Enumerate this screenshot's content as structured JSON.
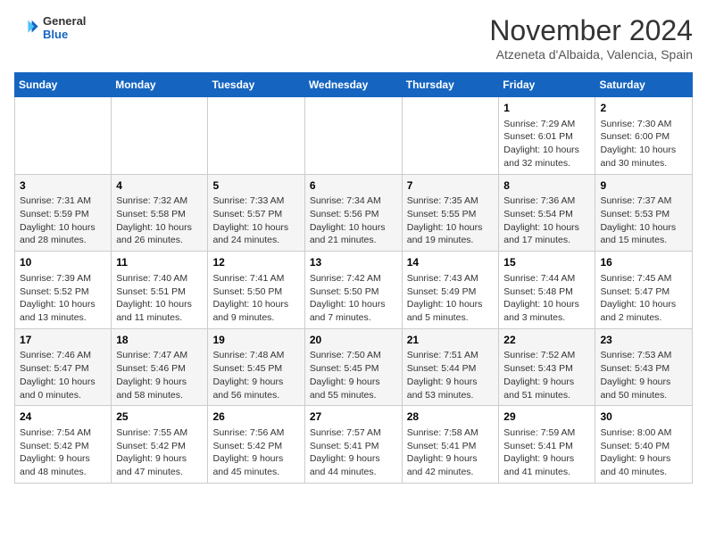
{
  "logo": {
    "line1": "General",
    "line2": "Blue"
  },
  "title": "November 2024",
  "location": "Atzeneta d'Albaida, Valencia, Spain",
  "days_of_week": [
    "Sunday",
    "Monday",
    "Tuesday",
    "Wednesday",
    "Thursday",
    "Friday",
    "Saturday"
  ],
  "weeks": [
    [
      {
        "day": "",
        "info": ""
      },
      {
        "day": "",
        "info": ""
      },
      {
        "day": "",
        "info": ""
      },
      {
        "day": "",
        "info": ""
      },
      {
        "day": "",
        "info": ""
      },
      {
        "day": "1",
        "info": "Sunrise: 7:29 AM\nSunset: 6:01 PM\nDaylight: 10 hours and 32 minutes."
      },
      {
        "day": "2",
        "info": "Sunrise: 7:30 AM\nSunset: 6:00 PM\nDaylight: 10 hours and 30 minutes."
      }
    ],
    [
      {
        "day": "3",
        "info": "Sunrise: 7:31 AM\nSunset: 5:59 PM\nDaylight: 10 hours and 28 minutes."
      },
      {
        "day": "4",
        "info": "Sunrise: 7:32 AM\nSunset: 5:58 PM\nDaylight: 10 hours and 26 minutes."
      },
      {
        "day": "5",
        "info": "Sunrise: 7:33 AM\nSunset: 5:57 PM\nDaylight: 10 hours and 24 minutes."
      },
      {
        "day": "6",
        "info": "Sunrise: 7:34 AM\nSunset: 5:56 PM\nDaylight: 10 hours and 21 minutes."
      },
      {
        "day": "7",
        "info": "Sunrise: 7:35 AM\nSunset: 5:55 PM\nDaylight: 10 hours and 19 minutes."
      },
      {
        "day": "8",
        "info": "Sunrise: 7:36 AM\nSunset: 5:54 PM\nDaylight: 10 hours and 17 minutes."
      },
      {
        "day": "9",
        "info": "Sunrise: 7:37 AM\nSunset: 5:53 PM\nDaylight: 10 hours and 15 minutes."
      }
    ],
    [
      {
        "day": "10",
        "info": "Sunrise: 7:39 AM\nSunset: 5:52 PM\nDaylight: 10 hours and 13 minutes."
      },
      {
        "day": "11",
        "info": "Sunrise: 7:40 AM\nSunset: 5:51 PM\nDaylight: 10 hours and 11 minutes."
      },
      {
        "day": "12",
        "info": "Sunrise: 7:41 AM\nSunset: 5:50 PM\nDaylight: 10 hours and 9 minutes."
      },
      {
        "day": "13",
        "info": "Sunrise: 7:42 AM\nSunset: 5:50 PM\nDaylight: 10 hours and 7 minutes."
      },
      {
        "day": "14",
        "info": "Sunrise: 7:43 AM\nSunset: 5:49 PM\nDaylight: 10 hours and 5 minutes."
      },
      {
        "day": "15",
        "info": "Sunrise: 7:44 AM\nSunset: 5:48 PM\nDaylight: 10 hours and 3 minutes."
      },
      {
        "day": "16",
        "info": "Sunrise: 7:45 AM\nSunset: 5:47 PM\nDaylight: 10 hours and 2 minutes."
      }
    ],
    [
      {
        "day": "17",
        "info": "Sunrise: 7:46 AM\nSunset: 5:47 PM\nDaylight: 10 hours and 0 minutes."
      },
      {
        "day": "18",
        "info": "Sunrise: 7:47 AM\nSunset: 5:46 PM\nDaylight: 9 hours and 58 minutes."
      },
      {
        "day": "19",
        "info": "Sunrise: 7:48 AM\nSunset: 5:45 PM\nDaylight: 9 hours and 56 minutes."
      },
      {
        "day": "20",
        "info": "Sunrise: 7:50 AM\nSunset: 5:45 PM\nDaylight: 9 hours and 55 minutes."
      },
      {
        "day": "21",
        "info": "Sunrise: 7:51 AM\nSunset: 5:44 PM\nDaylight: 9 hours and 53 minutes."
      },
      {
        "day": "22",
        "info": "Sunrise: 7:52 AM\nSunset: 5:43 PM\nDaylight: 9 hours and 51 minutes."
      },
      {
        "day": "23",
        "info": "Sunrise: 7:53 AM\nSunset: 5:43 PM\nDaylight: 9 hours and 50 minutes."
      }
    ],
    [
      {
        "day": "24",
        "info": "Sunrise: 7:54 AM\nSunset: 5:42 PM\nDaylight: 9 hours and 48 minutes."
      },
      {
        "day": "25",
        "info": "Sunrise: 7:55 AM\nSunset: 5:42 PM\nDaylight: 9 hours and 47 minutes."
      },
      {
        "day": "26",
        "info": "Sunrise: 7:56 AM\nSunset: 5:42 PM\nDaylight: 9 hours and 45 minutes."
      },
      {
        "day": "27",
        "info": "Sunrise: 7:57 AM\nSunset: 5:41 PM\nDaylight: 9 hours and 44 minutes."
      },
      {
        "day": "28",
        "info": "Sunrise: 7:58 AM\nSunset: 5:41 PM\nDaylight: 9 hours and 42 minutes."
      },
      {
        "day": "29",
        "info": "Sunrise: 7:59 AM\nSunset: 5:41 PM\nDaylight: 9 hours and 41 minutes."
      },
      {
        "day": "30",
        "info": "Sunrise: 8:00 AM\nSunset: 5:40 PM\nDaylight: 9 hours and 40 minutes."
      }
    ]
  ]
}
